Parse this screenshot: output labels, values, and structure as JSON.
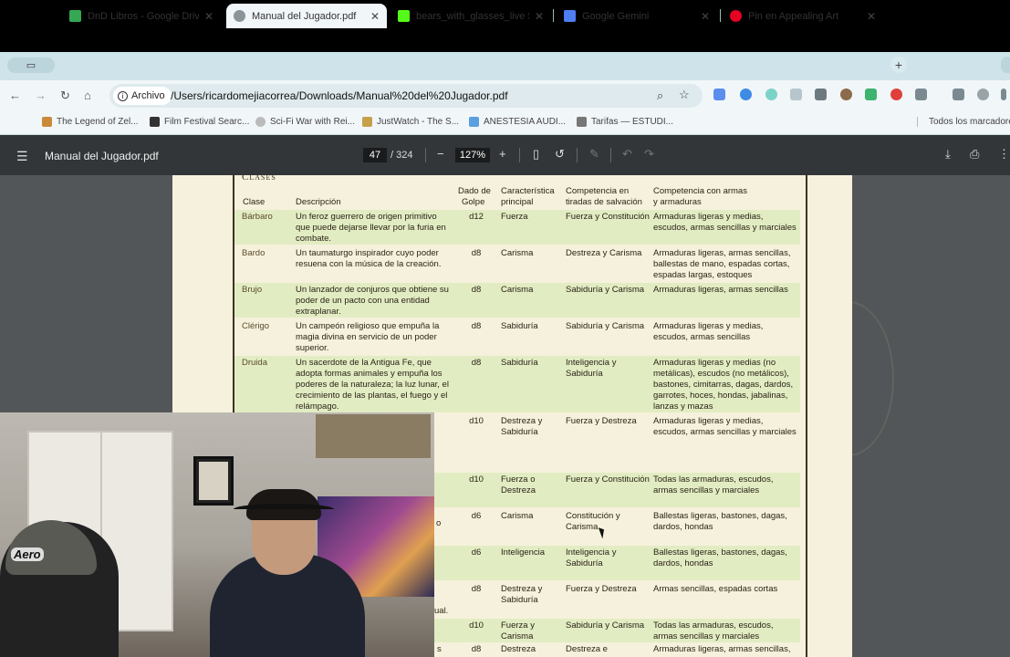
{
  "tabs": [
    {
      "label": "DnD Libros - Google Drive",
      "favicon_color": "#34a853"
    },
    {
      "label": "Manual del Jugador.pdf",
      "favicon_color": "#6f7a80"
    },
    {
      "label": "bears_with_glasses_live Stre",
      "favicon_color": "#53fc18"
    },
    {
      "label": "Google Gemini",
      "favicon_color": "#4f7df3"
    },
    {
      "label": "Pin en Appealing Art",
      "favicon_color": "#e60023"
    }
  ],
  "toolbar": {
    "site_chip": "Archivo",
    "url": "/Users/ricardomejiacorrea/Downloads/Manual%20del%20Jugador.pdf"
  },
  "bookmarks": [
    {
      "label": "The Legend of Zel...",
      "color": "#c88a3a"
    },
    {
      "label": "Film Festival Searc...",
      "color": "#333333"
    },
    {
      "label": "Sci-Fi War with Rei...",
      "color": "#bbbbbb"
    },
    {
      "label": "JustWatch - The S...",
      "color": "#c6a04a"
    },
    {
      "label": "ANESTESIA AUDI...",
      "color": "#5aa0e0"
    },
    {
      "label": "Tarifas — ESTUDI...",
      "color": "#777777"
    }
  ],
  "bookmarks_all": "Todos los marcadores",
  "pdf": {
    "title": "Manual del Jugador.pdf",
    "page_current": "47",
    "page_total": "/ 324",
    "zoom": "127%"
  },
  "table": {
    "section_title": "Clases",
    "headers": {
      "clase": "Clase",
      "descripcion": "Descripción",
      "dado_1": "Dado de",
      "dado_2": "Golpe",
      "carac_1": "Característica",
      "carac_2": "principal",
      "comp_1": "Competencia en",
      "comp_2": "tiradas de salvación",
      "armas_1": "Competencia con armas",
      "armas_2": "y armaduras"
    },
    "rows": [
      {
        "clase": "Bárbaro",
        "desc": "Un feroz guerrero de origen primitivo que puede dejarse llevar por la furia en combate.",
        "dado": "d12",
        "carac": "Fuerza",
        "salv": "Fuerza y Constitución",
        "armas": "Armaduras ligeras y medias, escudos, armas sencillas y marciales"
      },
      {
        "clase": "Bardo",
        "desc": "Un taumaturgo inspirador cuyo poder resuena con la música de la creación.",
        "dado": "d8",
        "carac": "Carisma",
        "salv": "Destreza y Carisma",
        "armas": "Armaduras ligeras, armas sencillas, ballestas de mano, espadas cortas, espadas largas, estoques"
      },
      {
        "clase": "Brujo",
        "desc": "Un lanzador de conjuros que obtiene su poder de un pacto con una entidad extraplanar.",
        "dado": "d8",
        "carac": "Carisma",
        "salv": "Sabiduría y Carisma",
        "armas": "Armaduras ligeras, armas sencillas"
      },
      {
        "clase": "Clérigo",
        "desc": "Un campeón religioso que empuña la magia divina en servicio de un poder superior.",
        "dado": "d8",
        "carac": "Sabiduría",
        "salv": "Sabiduría y Carisma",
        "armas": "Armaduras ligeras y medias, escudos, armas sencillas"
      },
      {
        "clase": "Druida",
        "desc": "Un sacerdote de la Antigua Fe, que adopta formas animales y empuña los poderes de la naturaleza; la luz lunar, el crecimiento de las plantas, el fuego y el relámpago.",
        "dado": "d8",
        "carac": "Sabiduría",
        "salv": "Inteligencia y Sabiduría",
        "armas": "Armaduras ligeras y medias (no metálicas), escudos (no metálicos), bastones, cimitarras, dagas, dardos, garrotes, hoces, hondas, jabalinas, lanzas y mazas"
      },
      {
        "clase": "",
        "desc": "",
        "dado": "d10",
        "carac": "Destreza y Sabiduría",
        "salv": "Fuerza y Destreza",
        "armas": "Armaduras ligeras y medias, escudos, armas sencillas y marciales"
      },
      {
        "clase": "",
        "desc": "",
        "dado": "d10",
        "carac": "Fuerza o Destreza",
        "salv": "Fuerza y Constitución",
        "armas": "Todas las armaduras, escudos, armas sencillas y marciales"
      },
      {
        "clase": "",
        "desc": "o",
        "dado": "d6",
        "carac": "Carisma",
        "salv": "Constitución y Carisma",
        "armas": "Ballestas ligeras, bastones, dagas, dardos, hondas"
      },
      {
        "clase": "",
        "desc": "",
        "dado": "d6",
        "carac": "Inteligencia",
        "salv": "Inteligencia y Sabiduría",
        "armas": "Ballestas ligeras, bastones, dagas, dardos, hondas"
      },
      {
        "clase": "",
        "desc": "ual.",
        "dado": "d8",
        "carac": "Destreza y Sabiduría",
        "salv": "Fuerza y Destreza",
        "armas": "Armas sencillas, espadas cortas"
      },
      {
        "clase": "",
        "desc": "",
        "dado": "d10",
        "carac": "Fuerza y Carisma",
        "salv": "Sabiduría y Carisma",
        "armas": "Todas las armaduras, escudos, armas sencillas y marciales"
      },
      {
        "clase": "",
        "desc": "s",
        "dado": "d8",
        "carac": "Destreza",
        "salv": "Destreza e",
        "armas": "Armaduras ligeras, armas sencillas,"
      }
    ]
  },
  "webcam": {
    "cap_text": "Aero"
  }
}
